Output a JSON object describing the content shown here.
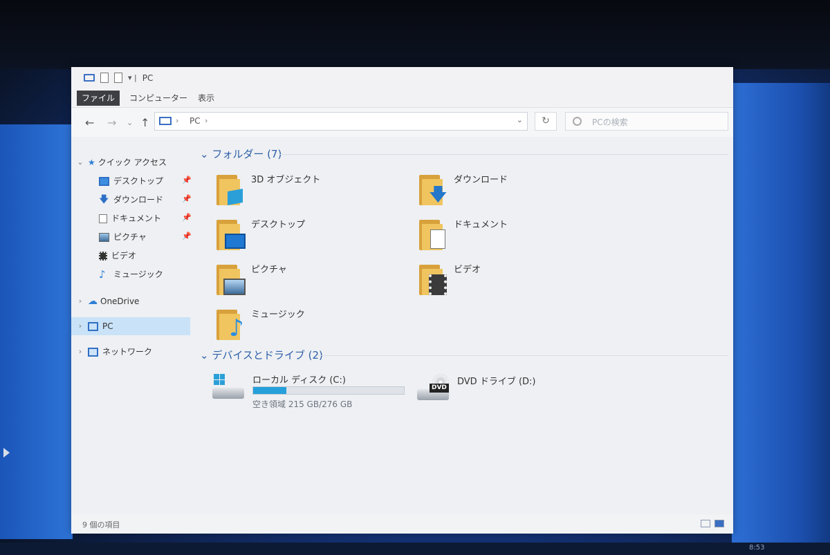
{
  "window": {
    "title": "PC",
    "status_text": "9 個の項目"
  },
  "ribbon": {
    "tabs": [
      "ファイル",
      "コンピューター",
      "表示"
    ]
  },
  "address": {
    "path": "PC",
    "search_placeholder": "PCの検索"
  },
  "sidebar": {
    "quick_access": "クイック アクセス",
    "quick_items": [
      {
        "label": "デスクトップ",
        "icon": "desktop-icon",
        "pinned": true
      },
      {
        "label": "ダウンロード",
        "icon": "download-icon",
        "pinned": true
      },
      {
        "label": "ドキュメント",
        "icon": "document-icon",
        "pinned": true
      },
      {
        "label": "ピクチャ",
        "icon": "picture-icon",
        "pinned": true
      },
      {
        "label": "ビデオ",
        "icon": "video-icon",
        "pinned": false
      },
      {
        "label": "ミュージック",
        "icon": "music-icon",
        "pinned": false
      }
    ],
    "onedrive": "OneDrive",
    "pc": "PC",
    "network": "ネットワーク"
  },
  "folders": {
    "header": "フォルダー (7)",
    "items": [
      {
        "label": "3D オブジェクト",
        "overlay": "cube-icon"
      },
      {
        "label": "ダウンロード",
        "overlay": "download-arrow-icon"
      },
      {
        "label": "デスクトップ",
        "overlay": "desktop-icon"
      },
      {
        "label": "ドキュメント",
        "overlay": "document-icon"
      },
      {
        "label": "ピクチャ",
        "overlay": "picture-icon"
      },
      {
        "label": "ビデオ",
        "overlay": "film-icon"
      },
      {
        "label": "ミュージック",
        "overlay": "music-note-icon"
      }
    ]
  },
  "devices": {
    "header": "デバイスとドライブ (2)",
    "local_disk": {
      "label": "ローカル ディスク (C:)",
      "free_text": "空き領域 215 GB/276 GB",
      "used_fraction": 0.22
    },
    "dvd": {
      "label": "DVD ドライブ (D:)",
      "badge": "DVD"
    }
  },
  "taskbar": {
    "clock": "8:53"
  },
  "colors": {
    "accent": "#26a0da",
    "folder": "#f0c560",
    "header_text": "#2e5fa8"
  }
}
